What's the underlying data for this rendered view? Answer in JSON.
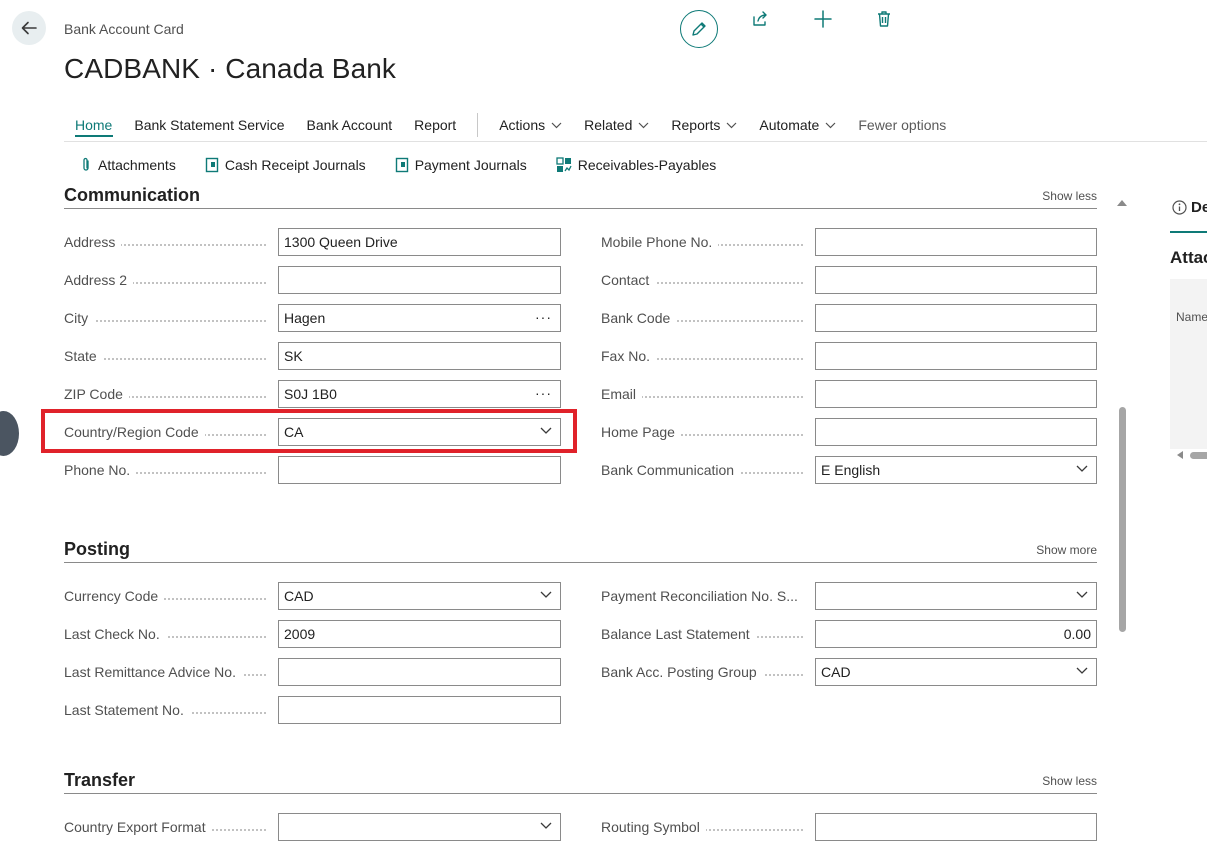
{
  "header": {
    "breadcrumb": "Bank Account Card",
    "title": "CADBANK · Canada Bank"
  },
  "ribbon": {
    "tabs": [
      {
        "label": "Home",
        "active": true
      },
      {
        "label": "Bank Statement Service"
      },
      {
        "label": "Bank Account"
      },
      {
        "label": "Report"
      }
    ],
    "menus": [
      {
        "label": "Actions"
      },
      {
        "label": "Related"
      },
      {
        "label": "Reports"
      },
      {
        "label": "Automate"
      }
    ],
    "fewer_options": "Fewer options"
  },
  "subbar": {
    "items": [
      {
        "label": "Attachments",
        "icon": "paperclip-icon"
      },
      {
        "label": "Cash Receipt Journals",
        "icon": "journal-icon"
      },
      {
        "label": "Payment Journals",
        "icon": "journal-icon"
      },
      {
        "label": "Receivables-Payables",
        "icon": "grid-chart-icon"
      }
    ]
  },
  "communication": {
    "title": "Communication",
    "toggle": "Show less",
    "left": [
      {
        "label": "Address",
        "value": "1300 Queen Drive",
        "type": "text"
      },
      {
        "label": "Address 2",
        "value": "",
        "type": "text"
      },
      {
        "label": "City",
        "value": "Hagen",
        "type": "lookup"
      },
      {
        "label": "State",
        "value": "SK",
        "type": "text"
      },
      {
        "label": "ZIP Code",
        "value": "S0J 1B0",
        "type": "lookup"
      },
      {
        "label": "Country/Region Code",
        "value": "CA",
        "type": "select"
      },
      {
        "label": "Phone No.",
        "value": "",
        "type": "text"
      }
    ],
    "right": [
      {
        "label": "Mobile Phone No.",
        "value": "",
        "type": "text"
      },
      {
        "label": "Contact",
        "value": "",
        "type": "text"
      },
      {
        "label": "Bank Code",
        "value": "",
        "type": "text"
      },
      {
        "label": "Fax No.",
        "value": "",
        "type": "text"
      },
      {
        "label": "Email",
        "value": "",
        "type": "text"
      },
      {
        "label": "Home Page",
        "value": "",
        "type": "text"
      },
      {
        "label": "Bank Communication",
        "value": "E English",
        "type": "select"
      }
    ]
  },
  "posting": {
    "title": "Posting",
    "toggle": "Show more",
    "left": [
      {
        "label": "Currency Code",
        "value": "CAD",
        "type": "select"
      },
      {
        "label": "Last Check No.",
        "value": "2009",
        "type": "text"
      },
      {
        "label": "Last Remittance Advice No.",
        "value": "",
        "type": "text"
      },
      {
        "label": "Last Statement No.",
        "value": "",
        "type": "text"
      }
    ],
    "right": [
      {
        "label": "Payment Reconciliation No. S...",
        "value": "",
        "type": "select"
      },
      {
        "label": "Balance Last Statement",
        "value": "0.00",
        "type": "number"
      },
      {
        "label": "Bank Acc. Posting Group",
        "value": "CAD",
        "type": "select"
      }
    ]
  },
  "transfer": {
    "title": "Transfer",
    "toggle": "Show less",
    "left": [
      {
        "label": "Country Export Format",
        "value": "",
        "type": "select"
      }
    ],
    "right": [
      {
        "label": "Routing Symbol",
        "value": "",
        "type": "text"
      }
    ]
  },
  "factbox": {
    "tab_label": "De",
    "heading": "Attac",
    "column_name": "Name"
  },
  "colors": {
    "accent": "#0e7a77",
    "highlight": "#e0222a"
  }
}
